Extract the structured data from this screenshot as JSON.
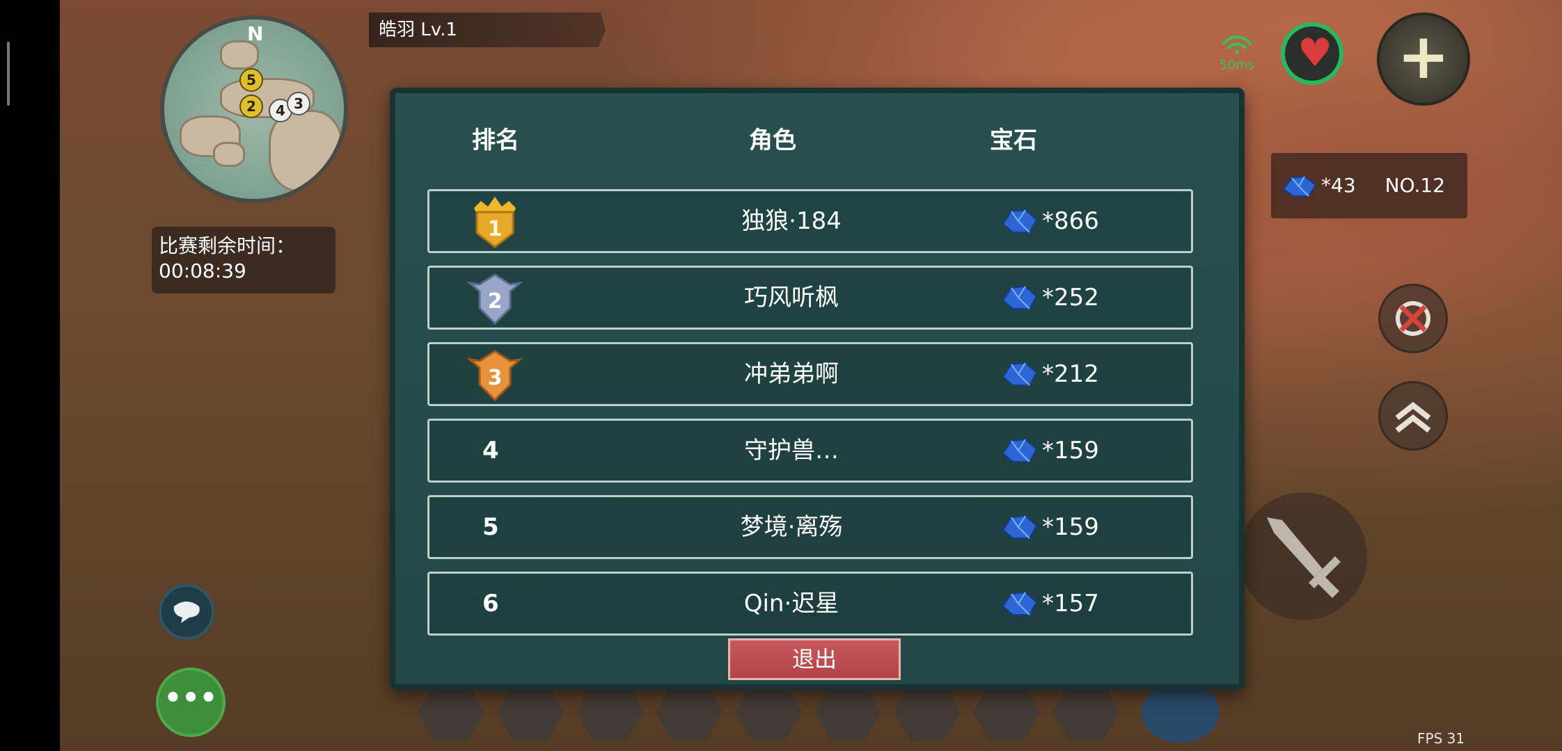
{
  "player": {
    "name_level": "皓羽 Lv.1"
  },
  "minimap": {
    "north_label": "N",
    "markers": [
      "5",
      "2",
      "4",
      "3"
    ]
  },
  "match_timer": {
    "label": "比赛剩余时间：",
    "value": "00:08:39"
  },
  "network": {
    "ping": "50ms"
  },
  "gem_status": {
    "count": "*43",
    "rank": "NO.12"
  },
  "leaderboard": {
    "headers": {
      "rank": "排名",
      "role": "角色",
      "gems": "宝石"
    },
    "rows": [
      {
        "rank": "1",
        "name": "独狼·184",
        "gems": "*866"
      },
      {
        "rank": "2",
        "name": "巧风听枫",
        "gems": "*252"
      },
      {
        "rank": "3",
        "name": "冲弟弟啊",
        "gems": "*212"
      },
      {
        "rank": "4",
        "name": "守护兽…",
        "gems": "*159"
      },
      {
        "rank": "5",
        "name": "梦境·离殇",
        "gems": "*159"
      },
      {
        "rank": "6",
        "name": "Qin·迟星",
        "gems": "*157"
      }
    ],
    "exit_label": "退出"
  },
  "fps": "FPS 31",
  "colors": {
    "panel": "#28504f",
    "gold": "#e8a92a",
    "silver": "#9aa6c7",
    "bronze": "#e5923b",
    "exit": "#c85a5e"
  }
}
